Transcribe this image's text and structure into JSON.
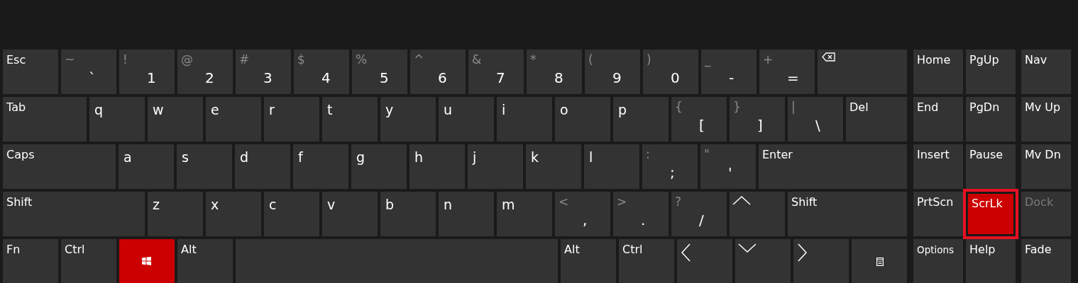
{
  "main_rows": [
    [
      {
        "kind": "label",
        "label": "Esc"
      },
      {
        "kind": "dual",
        "shift": "~",
        "label": "`"
      },
      {
        "kind": "dual",
        "shift": "!",
        "label": "1"
      },
      {
        "kind": "dual",
        "shift": "@",
        "label": "2"
      },
      {
        "kind": "dual",
        "shift": "#",
        "label": "3"
      },
      {
        "kind": "dual",
        "shift": "$",
        "label": "4"
      },
      {
        "kind": "dual",
        "shift": "%",
        "label": "5"
      },
      {
        "kind": "dual",
        "shift": "^",
        "label": "6"
      },
      {
        "kind": "dual",
        "shift": "&",
        "label": "7"
      },
      {
        "kind": "dual",
        "shift": "*",
        "label": "8"
      },
      {
        "kind": "dual",
        "shift": "(",
        "label": "9"
      },
      {
        "kind": "dual",
        "shift": ")",
        "label": "0"
      },
      {
        "kind": "dual",
        "shift": "_",
        "label": "-"
      },
      {
        "kind": "dual",
        "shift": "+",
        "label": "="
      },
      {
        "kind": "backspace"
      }
    ],
    [
      {
        "kind": "label",
        "label": "Tab"
      },
      {
        "kind": "letter",
        "label": "q"
      },
      {
        "kind": "letter",
        "label": "w"
      },
      {
        "kind": "letter",
        "label": "e"
      },
      {
        "kind": "letter",
        "label": "r"
      },
      {
        "kind": "letter",
        "label": "t"
      },
      {
        "kind": "letter",
        "label": "y"
      },
      {
        "kind": "letter",
        "label": "u"
      },
      {
        "kind": "letter",
        "label": "i"
      },
      {
        "kind": "letter",
        "label": "o"
      },
      {
        "kind": "letter",
        "label": "p"
      },
      {
        "kind": "dual",
        "shift": "{",
        "label": "["
      },
      {
        "kind": "dual",
        "shift": "}",
        "label": "]"
      },
      {
        "kind": "dual",
        "shift": "|",
        "label": "\\"
      },
      {
        "kind": "label",
        "label": "Del"
      }
    ],
    [
      {
        "kind": "label",
        "label": "Caps"
      },
      {
        "kind": "letter",
        "label": "a"
      },
      {
        "kind": "letter",
        "label": "s"
      },
      {
        "kind": "letter",
        "label": "d"
      },
      {
        "kind": "letter",
        "label": "f"
      },
      {
        "kind": "letter",
        "label": "g"
      },
      {
        "kind": "letter",
        "label": "h"
      },
      {
        "kind": "letter",
        "label": "j"
      },
      {
        "kind": "letter",
        "label": "k"
      },
      {
        "kind": "letter",
        "label": "l"
      },
      {
        "kind": "dual",
        "shift": ":",
        "label": ";"
      },
      {
        "kind": "dual",
        "shift": "\"",
        "label": "'"
      },
      {
        "kind": "label",
        "label": "Enter"
      }
    ],
    [
      {
        "kind": "label",
        "label": "Shift"
      },
      {
        "kind": "letter",
        "label": "z"
      },
      {
        "kind": "letter",
        "label": "x"
      },
      {
        "kind": "letter",
        "label": "c"
      },
      {
        "kind": "letter",
        "label": "v"
      },
      {
        "kind": "letter",
        "label": "b"
      },
      {
        "kind": "letter",
        "label": "n"
      },
      {
        "kind": "letter",
        "label": "m"
      },
      {
        "kind": "dual",
        "shift": "<",
        "label": ","
      },
      {
        "kind": "dual",
        "shift": ">",
        "label": "."
      },
      {
        "kind": "dual",
        "shift": "?",
        "label": "/"
      },
      {
        "kind": "arrow_up"
      },
      {
        "kind": "label",
        "label": "Shift"
      }
    ],
    [
      {
        "kind": "label",
        "label": "Fn"
      },
      {
        "kind": "label",
        "label": "Ctrl"
      },
      {
        "kind": "windows",
        "active": true
      },
      {
        "kind": "label",
        "label": "Alt"
      },
      {
        "kind": "space"
      },
      {
        "kind": "label",
        "label": "Alt"
      },
      {
        "kind": "label",
        "label": "Ctrl"
      },
      {
        "kind": "arrow_left"
      },
      {
        "kind": "arrow_down"
      },
      {
        "kind": "arrow_right"
      },
      {
        "kind": "menu"
      }
    ]
  ],
  "side_rows": [
    [
      {
        "kind": "label",
        "label": "Home"
      },
      {
        "kind": "label",
        "label": "PgUp"
      },
      {
        "kind": "label",
        "label": "Nav"
      }
    ],
    [
      {
        "kind": "label",
        "label": "End"
      },
      {
        "kind": "label",
        "label": "PgDn"
      },
      {
        "kind": "label",
        "label": "Mv Up"
      }
    ],
    [
      {
        "kind": "label",
        "label": "Insert"
      },
      {
        "kind": "label",
        "label": "Pause"
      },
      {
        "kind": "label",
        "label": "Mv Dn"
      }
    ],
    [
      {
        "kind": "label",
        "label": "PrtScn"
      },
      {
        "kind": "label",
        "label": "ScrLk",
        "active": true,
        "focused": true
      },
      {
        "kind": "label",
        "label": "Dock",
        "disabled": true
      }
    ],
    [
      {
        "kind": "small",
        "label": "Options"
      },
      {
        "kind": "label",
        "label": "Help"
      },
      {
        "kind": "label",
        "label": "Fade"
      }
    ]
  ]
}
